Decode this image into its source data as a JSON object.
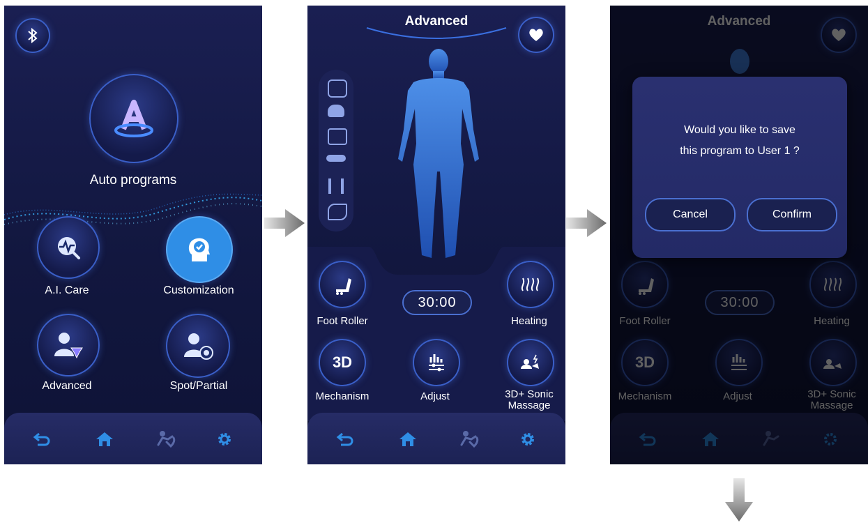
{
  "screen1": {
    "auto_programs_label": "Auto programs",
    "ai_care_label": "A.I. Care",
    "customization_label": "Customization",
    "advanced_label": "Advanced",
    "spot_partial_label": "Spot/Partial"
  },
  "screen2": {
    "title": "Advanced",
    "timer": "30:00",
    "foot_roller_label": "Foot Roller",
    "heating_label": "Heating",
    "mechanism_label": "Mechanism",
    "adjust_label": "Adjust",
    "sonic_label_line1": "3D+ Sonic",
    "sonic_label_line2": "Massage",
    "mechanism_icon_text": "3D"
  },
  "dialog": {
    "line1": "Would you like to save",
    "line2": "this program to User 1 ?",
    "cancel_label": "Cancel",
    "confirm_label": "Confirm"
  },
  "nav_icons": [
    "back-icon",
    "home-icon",
    "massage-icon",
    "gear-icon"
  ],
  "colors": {
    "accent": "#2f8ee6",
    "bg": "#141a46",
    "ring": "#3a5fc8"
  }
}
